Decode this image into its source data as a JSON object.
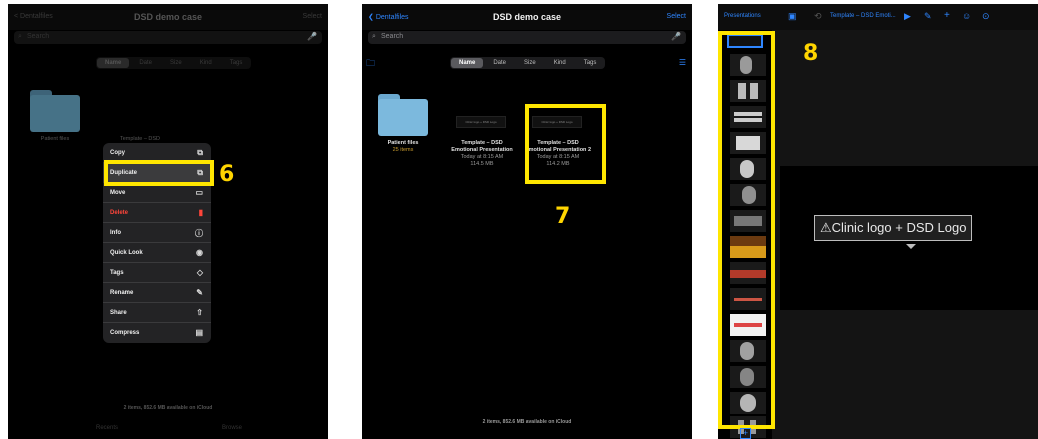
{
  "panel1": {
    "title": "DSD demo case",
    "nav_left": "< Dentalfiles",
    "nav_right": "Select",
    "search_placeholder": "Search",
    "sort_tabs": [
      "Name",
      "Date",
      "Size",
      "Kind",
      "Tags"
    ],
    "sort_active": 0,
    "folder_name": "Patient files",
    "folder_sub": "25 items",
    "file_caption": "Template – DSD",
    "context_menu": [
      {
        "label": "Copy",
        "icon": "copy-icon",
        "glyph": "⧉"
      },
      {
        "label": "Duplicate",
        "icon": "duplicate-icon",
        "glyph": "⧉"
      },
      {
        "label": "Move",
        "icon": "folder-icon",
        "glyph": "▭"
      },
      {
        "label": "Delete",
        "icon": "trash-icon",
        "glyph": "🗑"
      },
      {
        "label": "Info",
        "icon": "info-icon",
        "glyph": "ⓘ"
      },
      {
        "label": "Quick Look",
        "icon": "eye-icon",
        "glyph": "👁"
      },
      {
        "label": "Tags",
        "icon": "tag-icon",
        "glyph": "◇"
      },
      {
        "label": "Rename",
        "icon": "pencil-icon",
        "glyph": "✎"
      },
      {
        "label": "Share",
        "icon": "share-icon",
        "glyph": "⇪"
      },
      {
        "label": "Compress",
        "icon": "archive-icon",
        "glyph": "▤"
      }
    ],
    "footer": "2 items, 852.6 MB available on iCloud",
    "step_number": "6",
    "bottom_tabs": [
      "Recents",
      "Browse"
    ]
  },
  "panel2": {
    "title": "DSD demo case",
    "nav_left": "Dentalfiles",
    "nav_right": "Select",
    "search_placeholder": "Search",
    "sort_tabs": [
      "Name",
      "Date",
      "Size",
      "Kind",
      "Tags"
    ],
    "sort_active": 0,
    "folder_name": "Patient files",
    "folder_sub": "25 items",
    "file1": {
      "thumb_text": "Clinic logo + DSD Logo",
      "name_line1": "Template – DSD",
      "name_line2": "Emotional Presentation",
      "date": "Today at 8:15 AM",
      "size": "114.5 MB"
    },
    "file2": {
      "thumb_text": "Clinic logo + DSD Logo",
      "name_line1": "Template – DSD",
      "name_line2": "Emotional Presentation 2",
      "date": "Today at 8:15 AM",
      "size": "114.2 MB"
    },
    "footer": "2 items, 852.6 MB available on iCloud",
    "step_number": "7"
  },
  "panel3": {
    "nav_back": "Presentations",
    "doc_title": "Template – DSD Emoti...",
    "slide_banner": "Clinic logo + DSD Logo",
    "warning_glyph": "⚠",
    "slide_count": 15,
    "step_number": "8",
    "add_slide": "+"
  },
  "colors": {
    "highlight": "#ffe600",
    "link_blue": "#2f86ff",
    "folder": "#7cb9dd",
    "delete_red": "#ff453a"
  }
}
